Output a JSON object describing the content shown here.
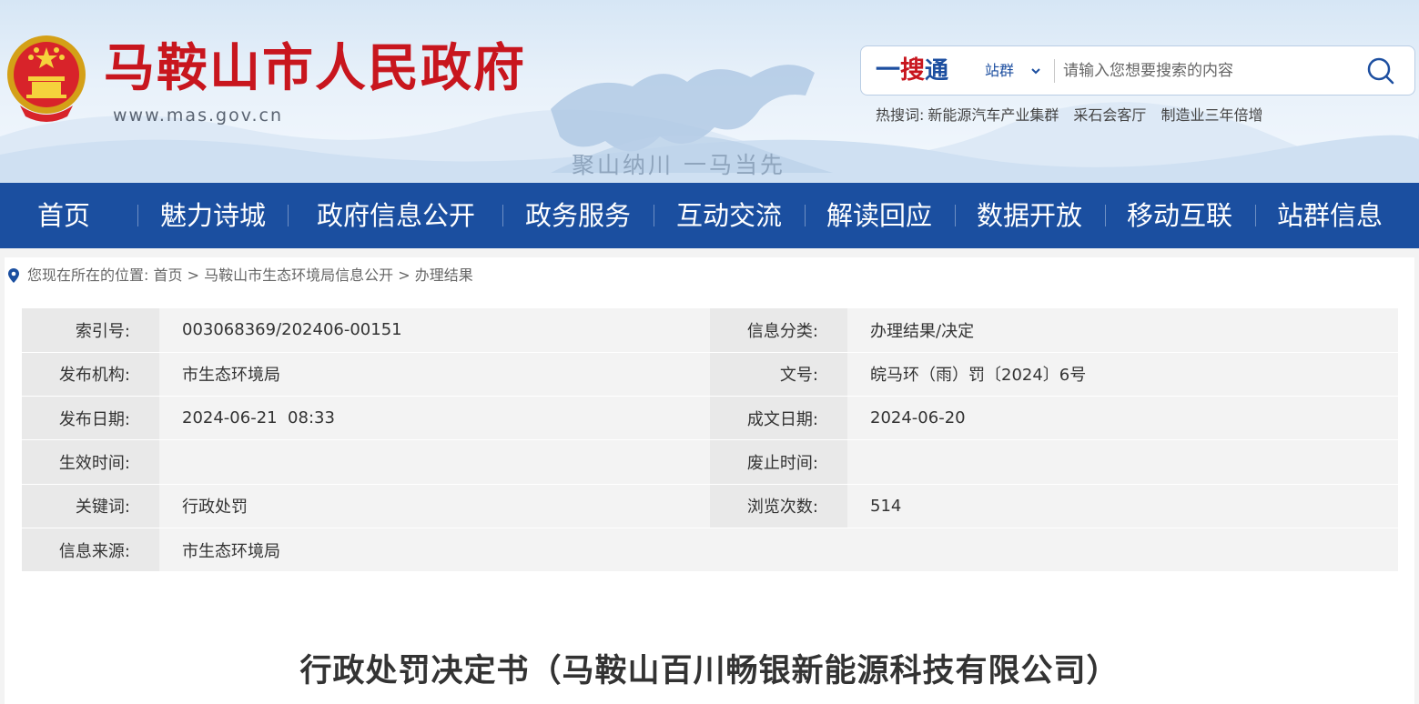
{
  "header": {
    "site_title": "马鞍山市人民政府",
    "site_url": "www.mas.gov.cn",
    "slogan": "聚山纳川 一马当先",
    "search": {
      "brand_yi": "一",
      "brand_sou": "搜",
      "brand_tong": "通",
      "scope_label": "站群",
      "placeholder": "请输入您想要搜索的内容"
    },
    "hot_search": {
      "label": "热搜词:",
      "terms": [
        "新能源汽车产业集群",
        "采石会客厅",
        "制造业三年倍增"
      ]
    }
  },
  "nav": {
    "items": [
      "首页",
      "魅力诗城",
      "政府信息公开",
      "政务服务",
      "互动交流",
      "解读回应",
      "数据开放",
      "移动互联",
      "站群信息"
    ]
  },
  "breadcrumb": {
    "prefix": "您现在所在的位置:",
    "items": [
      "首页",
      "马鞍山市生态环境局信息公开",
      "办理结果"
    ],
    "separator": ">"
  },
  "meta": {
    "index_no": {
      "label": "索引号:",
      "value": "003068369/202406-00151"
    },
    "category": {
      "label": "信息分类:",
      "value": "办理结果/决定"
    },
    "publisher": {
      "label": "发布机构:",
      "value": "市生态环境局"
    },
    "doc_no": {
      "label": "文号:",
      "value": "皖马环（雨）罚〔2024〕6号"
    },
    "publish_date": {
      "label": "发布日期:",
      "value": "2024-06-21  08:33"
    },
    "written_date": {
      "label": "成文日期:",
      "value": "2024-06-20"
    },
    "effective": {
      "label": "生效时间:",
      "value": ""
    },
    "abolished": {
      "label": "废止时间:",
      "value": ""
    },
    "keywords": {
      "label": "关键词:",
      "value": "行政处罚"
    },
    "views": {
      "label": "浏览次数:",
      "value": "514"
    },
    "source": {
      "label": "信息来源:",
      "value": "市生态环境局"
    }
  },
  "document": {
    "title": "行政处罚决定书（马鞍山百川畅银新能源科技有限公司）"
  },
  "colors": {
    "brand_red": "#c8161e",
    "nav_blue": "#1b4fa0",
    "label_bg": "#e9e9e9",
    "value_bg": "#f3f3f3"
  }
}
